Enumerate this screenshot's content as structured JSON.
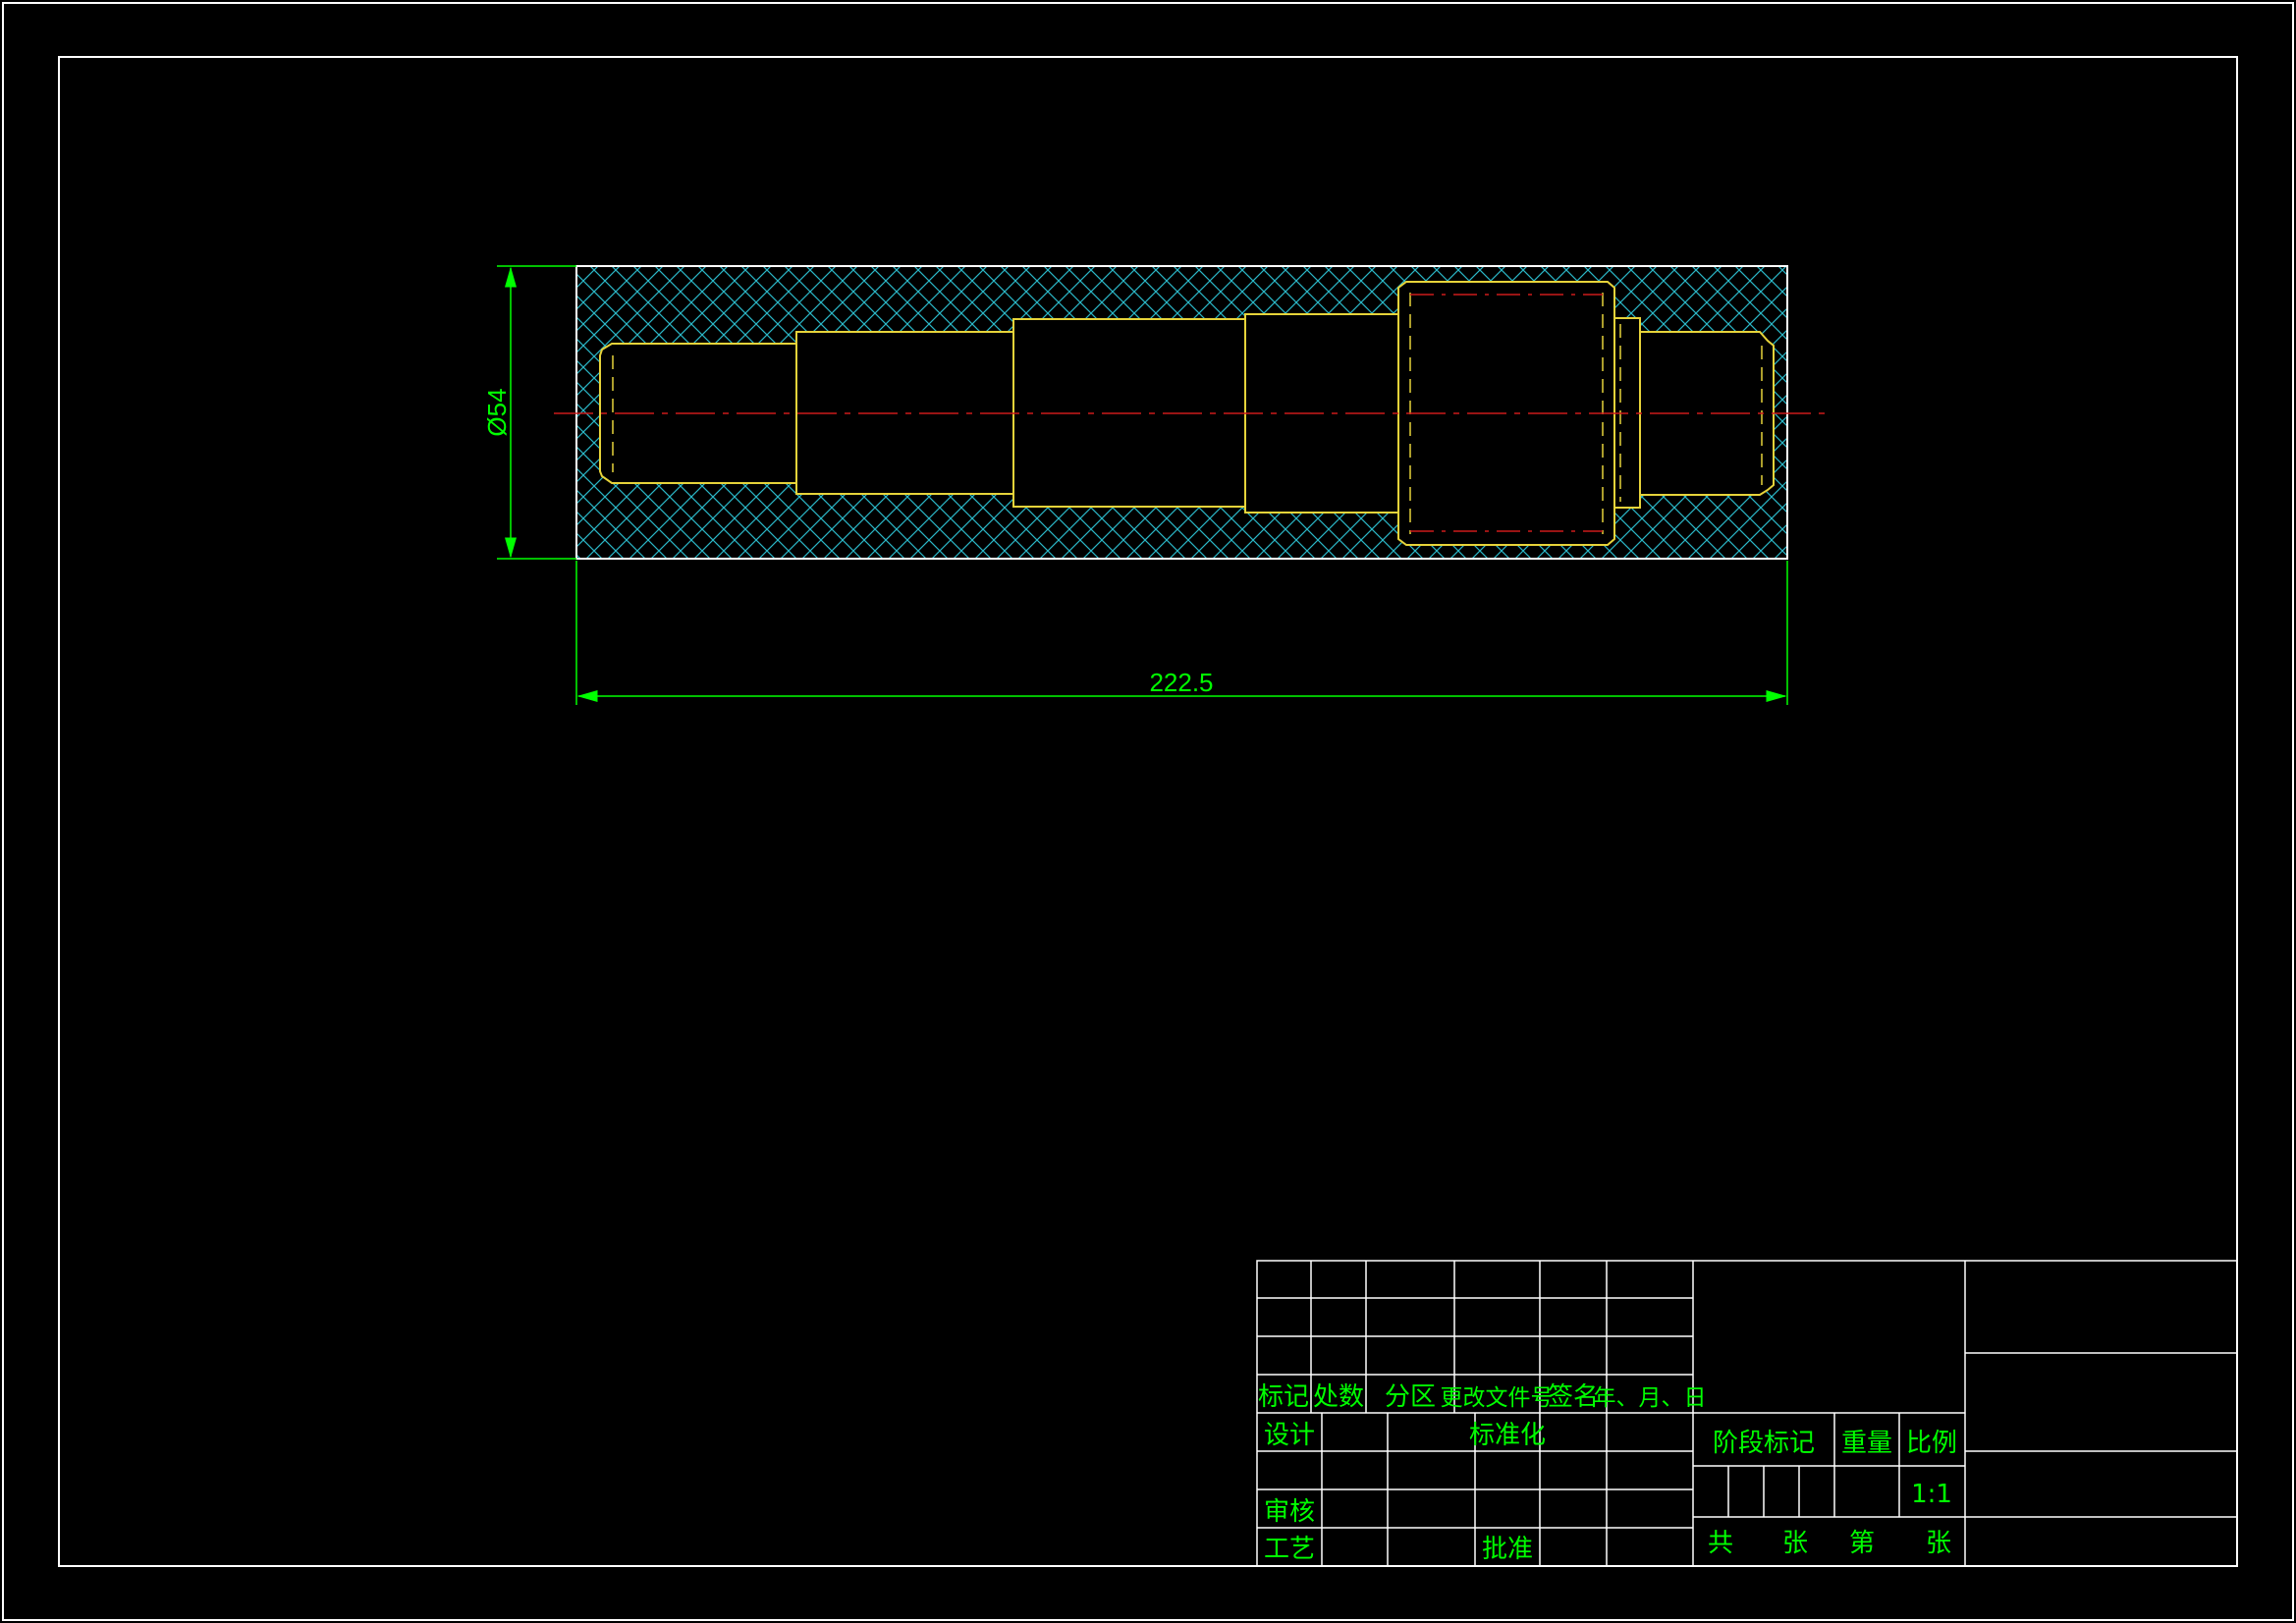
{
  "colors": {
    "background": "#000000",
    "frame": "#ffffff",
    "part_outline": "#e6d33a",
    "hatch": "#2bb7c7",
    "dimension": "#00ff00",
    "centerline": "#cc1a1a",
    "text": "#00ff00"
  },
  "drawing": {
    "dim_diameter": "Ø54",
    "dim_length": "222.5"
  },
  "title_block": {
    "revision_headers": [
      "标记",
      "处数",
      "分区",
      "更改文件号",
      "签名",
      "年、月、日"
    ],
    "design": "设计",
    "standardization": "标准化",
    "review": "审核",
    "process": "工艺",
    "approve": "批准",
    "stage_mark": "阶段标记",
    "weight": "重量",
    "scale": "比例",
    "scale_value": "1:1",
    "total": "共",
    "sheets": "张",
    "sheet_no": "第",
    "sheet_unit": "张"
  }
}
